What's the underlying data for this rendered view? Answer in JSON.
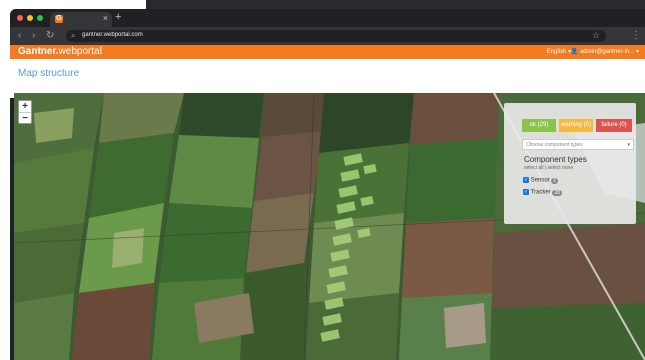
{
  "browser": {
    "tab": {
      "favicon_letter": "G",
      "close": "×"
    },
    "new_tab": "+",
    "nav": {
      "back": "‹",
      "forward": "›",
      "reload": "↻"
    },
    "url": "gantner.webportal.com",
    "search_glyph": "⌕",
    "star_glyph": "☆",
    "menu_glyph": "⋮",
    "traffic_colors": [
      "#ff5f57",
      "#febc2e",
      "#28c840"
    ]
  },
  "app": {
    "brand_prefix": "Gantner.",
    "brand_suffix": "webportal",
    "language": "English ▾",
    "user": "admin@gantner-in... ▾",
    "accent": "#f47b20"
  },
  "page": {
    "title": "Map structure"
  },
  "map": {
    "zoom_in": "+",
    "zoom_out": "−",
    "filters": [
      {
        "label": "ok (29)",
        "color": "#8bc34a"
      },
      {
        "label": "warning (0)",
        "color": "#f5b942"
      },
      {
        "label": "failure (0)",
        "color": "#d9534f"
      }
    ],
    "component_select": {
      "placeholder": "Choose component types",
      "caret": "▾"
    },
    "component_types": {
      "title": "Component types",
      "select_all": "select all",
      "separator": "|",
      "select_none": "select none",
      "items": [
        {
          "label": "Sensor",
          "count": "1"
        },
        {
          "label": "Tracker",
          "count": "28"
        }
      ]
    }
  }
}
